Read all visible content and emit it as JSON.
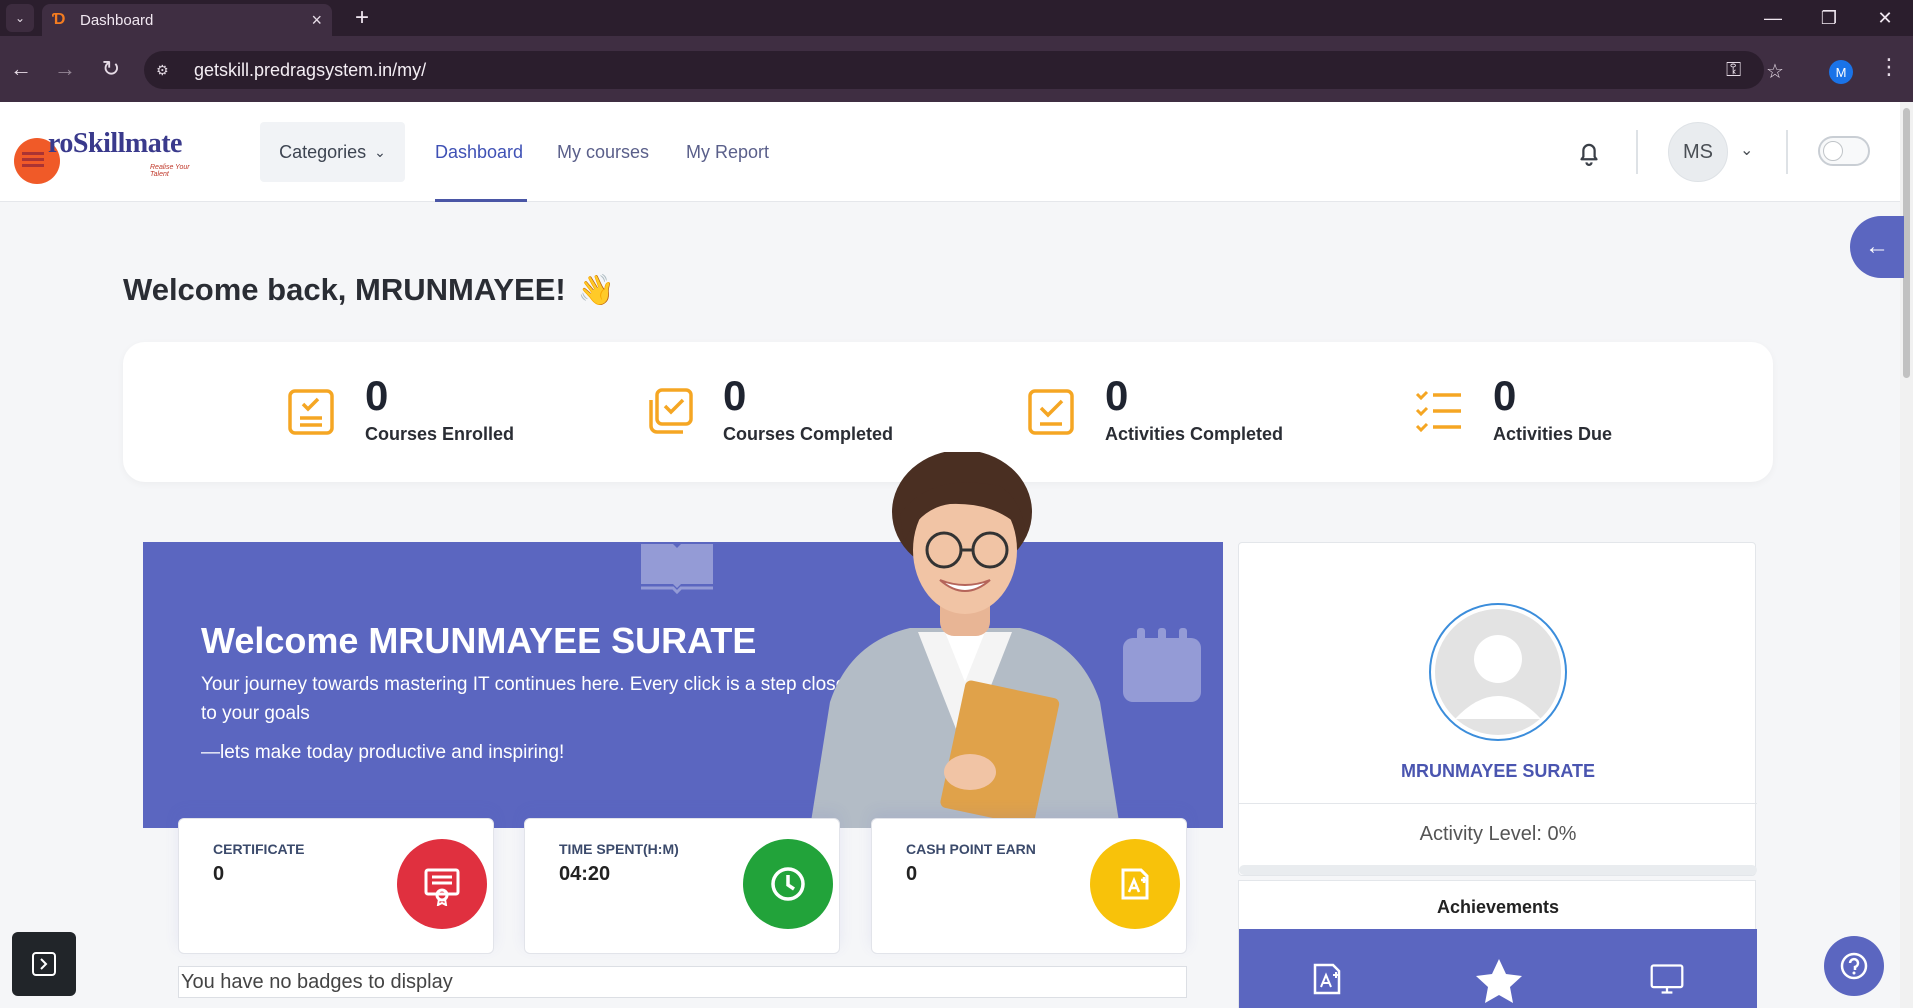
{
  "browser": {
    "tab_title": "Dashboard",
    "url": "getskill.predragsystem.in/my/",
    "profile_initial": "M"
  },
  "header": {
    "logo_text": "roSkillmate",
    "logo_tagline": "Realise Your Talent",
    "categories_label": "Categories",
    "nav": [
      {
        "label": "Dashboard",
        "active": true
      },
      {
        "label": "My courses",
        "active": false
      },
      {
        "label": "My Report",
        "active": false
      }
    ],
    "user_initials": "MS"
  },
  "welcome": {
    "title": "Welcome back, MRUNMAYEE!",
    "emoji": "👋"
  },
  "stats": [
    {
      "value": "0",
      "label": "Courses Enrolled",
      "icon": "clipboard-check-icon"
    },
    {
      "value": "0",
      "label": "Courses Completed",
      "icon": "copy-check-icon"
    },
    {
      "value": "0",
      "label": "Activities Completed",
      "icon": "check-square-icon"
    },
    {
      "value": "0",
      "label": "Activities Due",
      "icon": "checklist-icon"
    }
  ],
  "banner": {
    "title": "Welcome MRUNMAYEE SURATE",
    "paragraph": "Your journey towards mastering IT continues here. Every click is a step closer to your goals",
    "paragraph2": "—lets make today productive and inspiring!"
  },
  "mini_cards": [
    {
      "label": "CERTIFICATE",
      "value": "0",
      "icon": "certificate-icon",
      "color": "#e0303f"
    },
    {
      "label": "TIME SPENT(H:M)",
      "value": "04:20",
      "icon": "clock-icon",
      "color": "#22a33a"
    },
    {
      "label": "CASH POINT EARN",
      "value": "0",
      "icon": "file-add-icon",
      "color": "#f8c20a"
    }
  ],
  "badges_text": "You have no badges to display",
  "profile": {
    "name": "MRUNMAYEE SURATE",
    "activity_level": "Activity Level: 0%",
    "activity_percent": 0
  },
  "achievements": {
    "title": "Achievements"
  },
  "colors": {
    "primary": "#5b66c0",
    "accent": "#f5a623"
  }
}
